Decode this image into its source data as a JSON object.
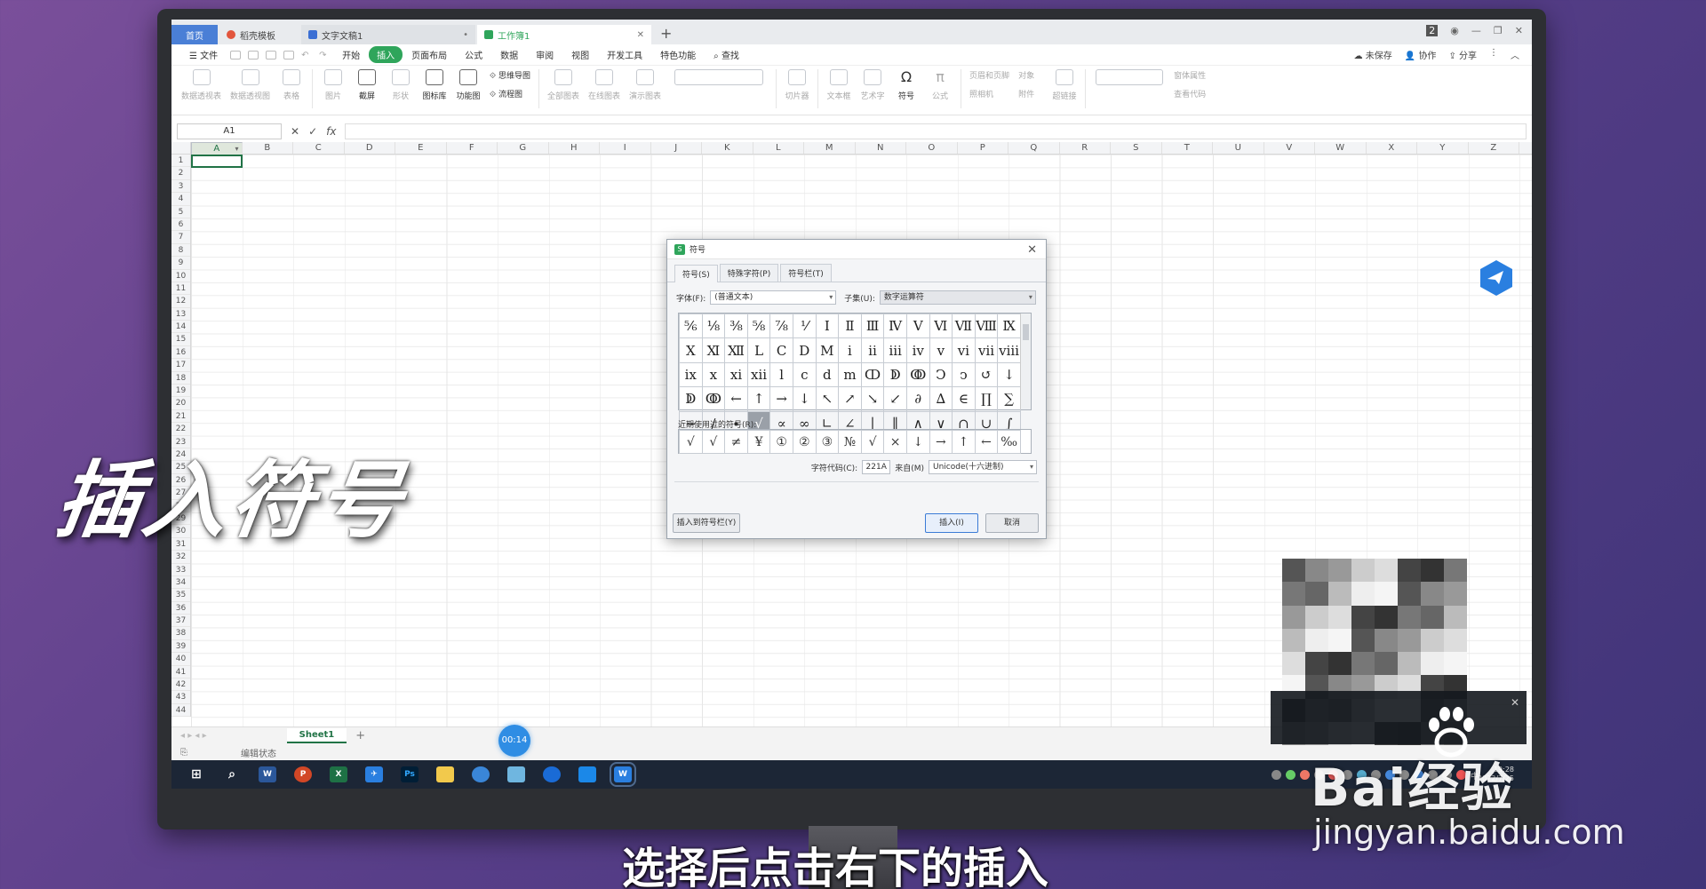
{
  "tabs": [
    {
      "label": "首页",
      "kind": "home"
    },
    {
      "label": "稻壳模板",
      "kind": "template"
    },
    {
      "label": "文字文稿1",
      "kind": "doc"
    },
    {
      "label": "工作簿1",
      "kind": "sheet",
      "active": true
    }
  ],
  "window_badge": "2",
  "menu": {
    "file": "文件",
    "items": [
      "开始",
      "插入",
      "页面布局",
      "公式",
      "数据",
      "审阅",
      "视图",
      "开发工具",
      "特色功能"
    ],
    "active": "插入",
    "search": "查找",
    "right": [
      "未保存",
      "协作",
      "分享"
    ]
  },
  "ribbon": [
    "数据透视表",
    "数据透视图",
    "表格",
    "图片",
    "截屏",
    "形状",
    "图标库",
    "功能图",
    "思维导图",
    "流程图",
    "全部图表",
    "在线图表",
    "演示图表",
    "切片器",
    "文本框",
    "艺术字",
    "符号",
    "公式",
    "页眉和页脚",
    "照相机",
    "对象",
    "附件",
    "超链接",
    "窗体属性",
    "查看代码"
  ],
  "formula_bar": {
    "cell_ref": "A1",
    "fx": "fx"
  },
  "columns": [
    "A",
    "B",
    "C",
    "D",
    "E",
    "F",
    "G",
    "H",
    "I",
    "J",
    "K",
    "L",
    "M",
    "N",
    "O",
    "P",
    "Q",
    "R",
    "S",
    "T",
    "U",
    "V",
    "W",
    "X",
    "Y",
    "Z"
  ],
  "rows": [
    "1",
    "2",
    "3",
    "4",
    "5",
    "6",
    "7",
    "8",
    "9",
    "10",
    "11",
    "12",
    "13",
    "14",
    "15",
    "16",
    "17",
    "18",
    "19",
    "20",
    "21",
    "22",
    "23",
    "24",
    "25",
    "26",
    "27",
    "28",
    "29",
    "30",
    "31",
    "32",
    "33",
    "34",
    "35",
    "36",
    "37",
    "38",
    "39",
    "40",
    "41",
    "42",
    "43",
    "44"
  ],
  "sheet_tab": "Sheet1",
  "status": "编辑状态",
  "timer": "00:14",
  "dialog": {
    "title": "符号",
    "tabs": [
      "符号(S)",
      "特殊字符(P)",
      "符号栏(T)"
    ],
    "font_label": "字体(F):",
    "font_value": "(普通文本)",
    "subset_label": "子集(U):",
    "subset_value": "数字运算符",
    "grid": [
      [
        "⅚",
        "⅛",
        "⅜",
        "⅝",
        "⅞",
        "⅟",
        "Ⅰ",
        "Ⅱ",
        "Ⅲ",
        "Ⅳ",
        "Ⅴ",
        "Ⅵ",
        "Ⅶ",
        "Ⅷ",
        "Ⅸ"
      ],
      [
        "Ⅹ",
        "Ⅺ",
        "Ⅻ",
        "Ⅼ",
        "Ⅽ",
        "Ⅾ",
        "Ⅿ",
        "ⅰ",
        "ⅱ",
        "ⅲ",
        "ⅳ",
        "ⅴ",
        "ⅵ",
        "ⅶ",
        "ⅷ"
      ],
      [
        "ⅸ",
        "ⅹ",
        "ⅺ",
        "ⅻ",
        "ⅼ",
        "ⅽ",
        "ⅾ",
        "ⅿ",
        "ↀ",
        "ↁ",
        "ↂ",
        "Ↄ",
        "ↄ",
        "↺",
        "↓"
      ],
      [
        "ↁ",
        "ↂ",
        "←",
        "↑",
        "→",
        "↓",
        "↖",
        "↗",
        "↘",
        "↙",
        "∂",
        "∆",
        "∈",
        "∏",
        "∑"
      ],
      [
        "−",
        "∕",
        "∙",
        "√",
        "∝",
        "∞",
        "∟",
        "∠",
        "∣",
        "∥",
        "∧",
        "∨",
        "∩",
        "∪",
        "∫"
      ]
    ],
    "highlight": [
      4,
      3
    ],
    "recent_label": "近期使用过的符号(R):",
    "recent": [
      "√",
      "√",
      "≠",
      "¥",
      "①",
      "②",
      "③",
      "№",
      "√",
      "×",
      "↓",
      "→",
      "↑",
      "←",
      "‰"
    ],
    "code_label": "字符代码(C):",
    "code_value": "221A",
    "from_label": "来自(M)",
    "from_value": "Unicode(十六进制)",
    "insert_to_bar": "插入到符号栏(Y)",
    "insert": "插入(I)",
    "cancel": "取消"
  },
  "clock": {
    "time": "19:28",
    "date": "2022/7/25"
  },
  "ime": "中",
  "overlay_title": "插入符号",
  "subtitle": "选择后点击右下的插入",
  "watermark": {
    "brand": "Bai经验",
    "url": "jingyan.baidu.com"
  },
  "colors": {
    "green": "#2fa55b",
    "blue": "#4a7fd6",
    "cell_border": "#217346"
  }
}
